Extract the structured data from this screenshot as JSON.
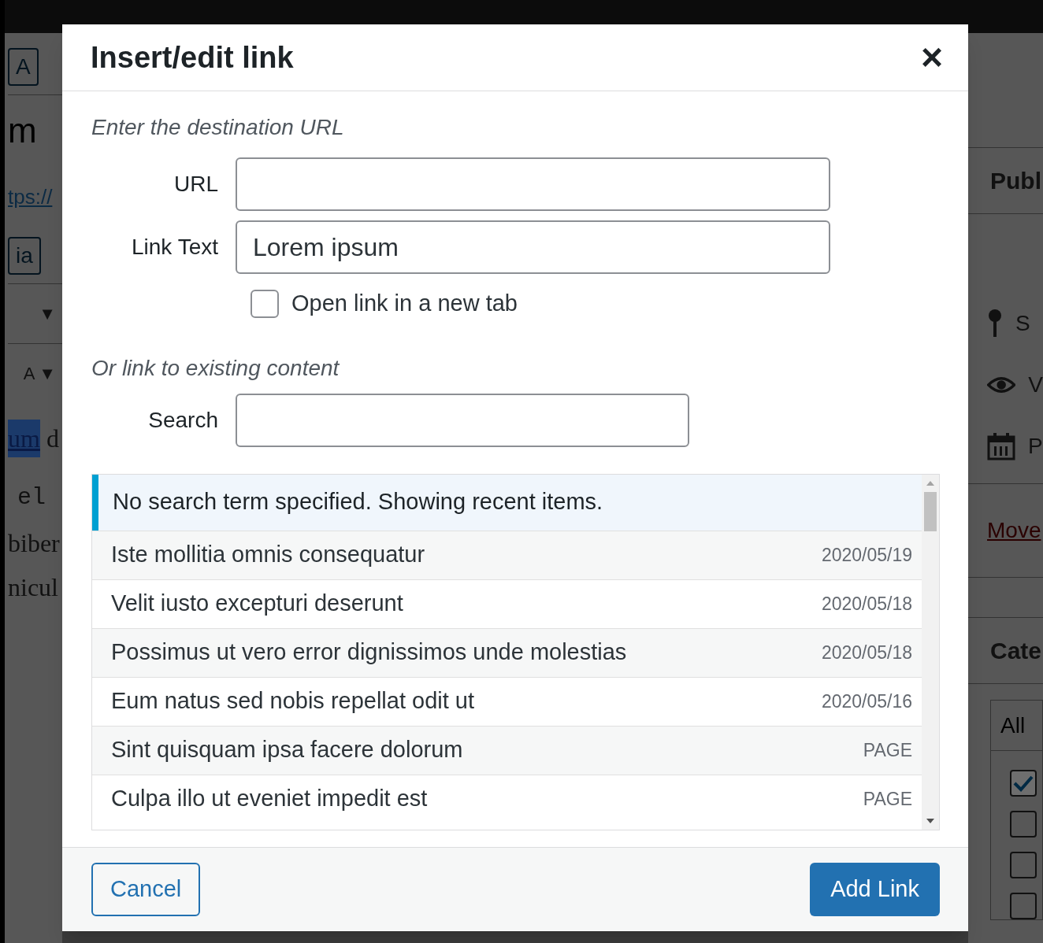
{
  "background": {
    "left": [
      {
        "kind": "button",
        "text": "A"
      },
      {
        "kind": "heading",
        "text": "m"
      },
      {
        "kind": "link",
        "text": "tps://"
      },
      {
        "kind": "button",
        "text": "ia"
      },
      {
        "kind": "caret",
        "text": "▼"
      },
      {
        "kind": "caret",
        "text": "A ▼"
      },
      {
        "kind": "highlight",
        "text": "um",
        "rest": "d"
      },
      {
        "kind": "mono",
        "text": "el"
      },
      {
        "kind": "serif",
        "text": "biber"
      },
      {
        "kind": "serif",
        "text": "nicul"
      }
    ],
    "right": {
      "title": "Publ",
      "status": [
        {
          "kind": "pin",
          "text": "S"
        },
        {
          "kind": "eye",
          "text": "V"
        },
        {
          "kind": "calendar",
          "text": "P"
        }
      ],
      "trash_link": "Move",
      "categories_title": "Cate",
      "categories_tab": "All",
      "checkboxes": [
        {
          "checked": true
        },
        {
          "checked": false
        },
        {
          "checked": false
        },
        {
          "checked": false
        }
      ]
    }
  },
  "dialog": {
    "title": "Insert/edit link",
    "close": "×",
    "url_heading": "Enter the destination URL",
    "fields": [
      {
        "label": "URL"
      },
      {
        "label": "Link Text",
        "value": "Lorem ipsum"
      }
    ],
    "new_tab": {
      "label": "Open link in a new tab",
      "checked": false
    },
    "existing_heading": "Or link to existing content",
    "search": {
      "label": "Search"
    },
    "notice": "No search term specified. Showing recent items.",
    "results": [
      {
        "title": "Iste mollitia omnis consequatur",
        "info": "2020/05/19"
      },
      {
        "title": "Velit iusto excepturi deserunt",
        "info": "2020/05/18"
      },
      {
        "title": "Possimus ut vero error dignissimos unde molestias",
        "info": "2020/05/18"
      },
      {
        "title": "Eum natus sed nobis repellat odit ut",
        "info": "2020/05/16"
      },
      {
        "title": "Sint quisquam ipsa facere dolorum",
        "info": "PAGE"
      },
      {
        "title": "Culpa illo ut eveniet impedit est",
        "info": "PAGE"
      }
    ],
    "buttons": {
      "cancel": "Cancel",
      "submit": "Add Link"
    }
  }
}
